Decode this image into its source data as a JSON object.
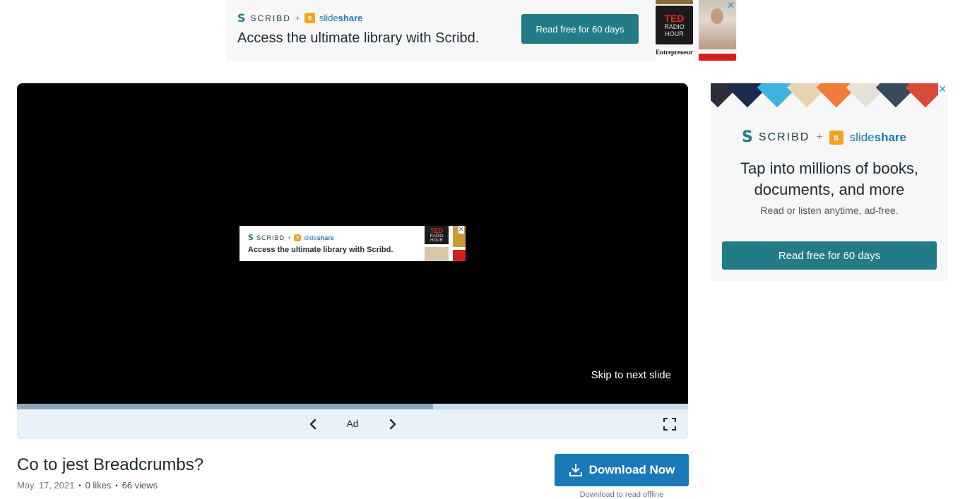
{
  "top_ad": {
    "brand_scribd": "SCRIBD",
    "brand_plus": "+",
    "brand_slideshare_light": "slide",
    "brand_slideshare_bold": "share",
    "tagline": "Access the ultimate library with Scribd.",
    "cta_label": "Read free for 60 days",
    "book_ted": "TED",
    "book_radio_hour": "RADIO HOUR",
    "book_entrepreneur": "Entrepreneur",
    "close_label": "✕"
  },
  "player": {
    "mini_ad": {
      "brand_scribd": "SCRIBD",
      "brand_plus": "+",
      "brand_slideshare_light": "slide",
      "brand_slideshare_bold": "share",
      "tagline": "Access the ultimate library with Scribd.",
      "book_ted": "TED",
      "book_radio_hour": "RADIO HOUR",
      "close_label": "✕"
    },
    "skip_label": "Skip to next slide",
    "progress_fraction": 0.62,
    "slide_label": "Ad"
  },
  "side_ad": {
    "brand_scribd": "SCRIBD",
    "brand_plus": "+",
    "brand_slideshare_light": "slide",
    "brand_slideshare_bold": "share",
    "headline_line1": "Tap into millions of books,",
    "headline_line2": "documents, and more",
    "sub": "Read or listen anytime, ad-free.",
    "cta_label": "Read free for 60 days",
    "close_label": "✕",
    "cover_colors": [
      "#2a2f3a",
      "#1c2b4a",
      "#3fb3e0",
      "#e8d3b0",
      "#f07a3a",
      "#e5e0d8",
      "#3a4a5a",
      "#d94a3a"
    ]
  },
  "document": {
    "title": "Co to jest Breadcrumbs?",
    "date": "May. 17, 2021",
    "likes": "0 likes",
    "views": "66 views",
    "separator": "•",
    "download_label": "Download Now",
    "download_sub": "Download to read offline"
  },
  "colors": {
    "accent_teal": "#237b88",
    "accent_blue": "#1a7ab7",
    "controls_bg": "#e7f2fa"
  }
}
